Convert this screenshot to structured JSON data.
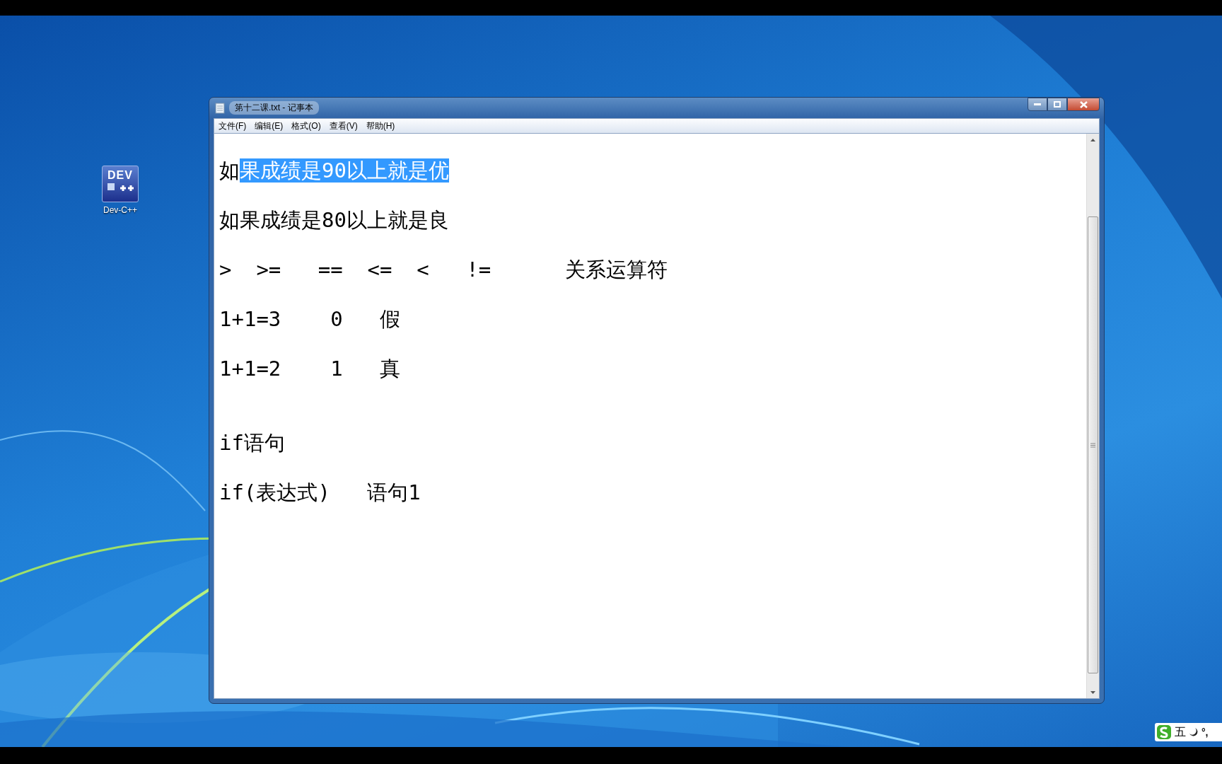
{
  "desktop": {
    "icons": [
      {
        "label": "Dev-C++",
        "logo_text": "DEV"
      }
    ]
  },
  "window": {
    "title": "第十二课.txt - 记事本",
    "menu": [
      "文件(F)",
      "编辑(E)",
      "格式(O)",
      "查看(V)",
      "帮助(H)"
    ],
    "blocks": [
      {
        "lines": [
          {
            "segments": [
              {
                "text": "如",
                "selected": false
              },
              {
                "text": "果成绩是90以上就是优",
                "selected": true
              }
            ]
          },
          {
            "segments": [
              {
                "text": "如果成绩是80以上就是良",
                "selected": false
              }
            ]
          },
          {
            "segments": [
              {
                "text": ">  >=   ==  <=  <   !=      关系运算符",
                "selected": false
              }
            ]
          },
          {
            "segments": [
              {
                "text": "1+1=3    0   假",
                "selected": false
              }
            ]
          },
          {
            "segments": [
              {
                "text": "1+1=2    1   真",
                "selected": false
              }
            ]
          }
        ]
      },
      {
        "lines": [
          {
            "segments": [
              {
                "text": "if语句",
                "selected": false
              }
            ]
          },
          {
            "segments": [
              {
                "text": "if(表达式)   语句1",
                "selected": false
              }
            ]
          }
        ]
      }
    ]
  },
  "ime": {
    "mode": "五",
    "punct": "°,"
  }
}
